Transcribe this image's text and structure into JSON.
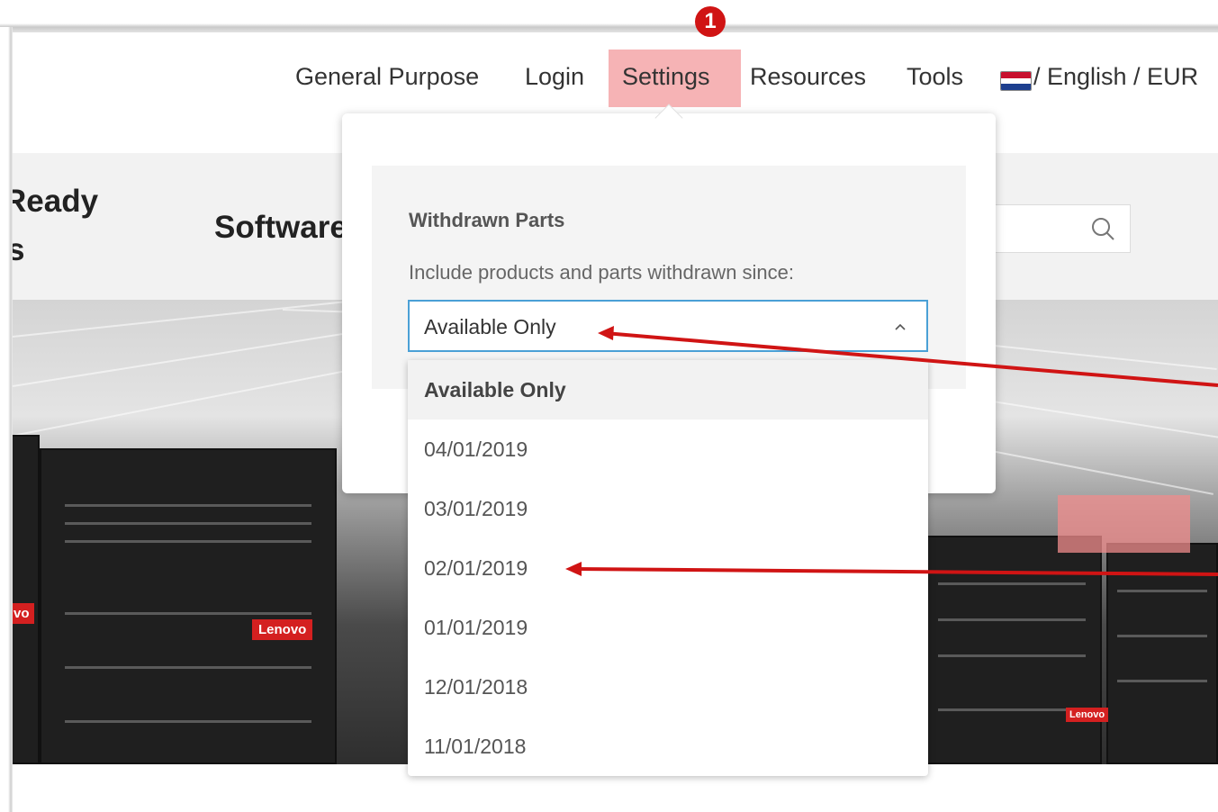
{
  "nav": {
    "items": [
      "General Purpose",
      "Login",
      "Settings",
      "Resources",
      "Tools"
    ],
    "locale": "/ English / EUR"
  },
  "header": {
    "brand_line1": "Ready",
    "brand_line2": "s",
    "software_label": "Software"
  },
  "settings_panel": {
    "title": "Withdrawn Parts",
    "description": "Include products and parts withdrawn since:",
    "selected_value": "Available Only",
    "options": [
      "Available Only",
      "04/01/2019",
      "03/01/2019",
      "02/01/2019",
      "01/01/2019",
      "12/01/2018",
      "11/01/2018"
    ]
  },
  "hero": {
    "badges": [
      "Lenovo",
      "vo",
      "Lenovo"
    ]
  },
  "annotation": {
    "step_number": "1",
    "color": "#d01414"
  },
  "icons": {
    "search": "search-icon",
    "flag": "netherlands-flag-icon",
    "chevron": "chevron-up-icon"
  }
}
